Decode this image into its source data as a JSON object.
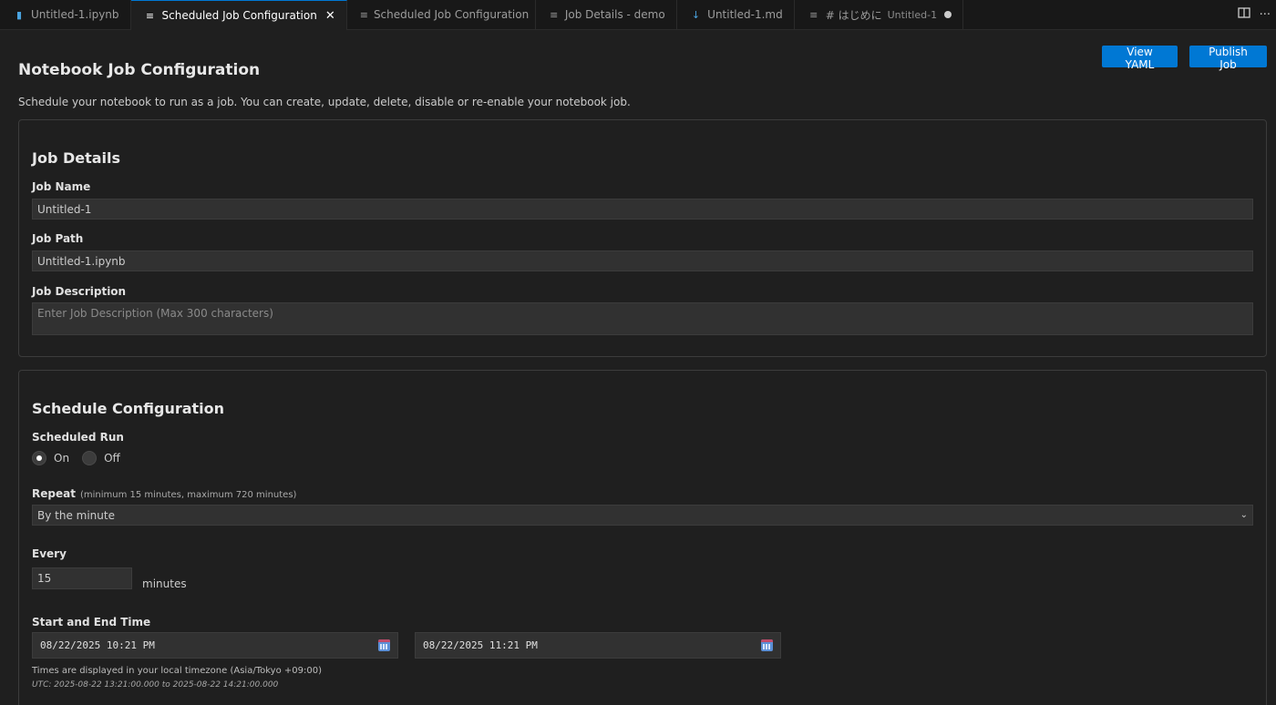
{
  "tabs": [
    {
      "label": "Untitled-1.ipynb",
      "icon": "notebook-icon",
      "active": false
    },
    {
      "label": "Scheduled Job Configuration",
      "icon": "preview-icon",
      "active": true
    },
    {
      "label": "Scheduled Job Configuration",
      "icon": "preview-icon",
      "active": false
    },
    {
      "label": "Job Details - demo",
      "icon": "preview-icon",
      "active": false
    },
    {
      "label": "Untitled-1.md",
      "icon": "markdown-icon",
      "active": false
    },
    {
      "label": "# はじめに",
      "suffix": "Untitled-1",
      "icon": "preview-icon",
      "active": false,
      "dirty": true
    }
  ],
  "tab_actions": {
    "split": "split-editor-icon",
    "more": "···"
  },
  "header": {
    "title": "Notebook Job Configuration",
    "description": "Schedule your notebook to run as a job. You can create, update, delete, disable or re-enable your notebook job.",
    "view_yaml_label": "View YAML",
    "publish_label": "Publish Job"
  },
  "job_details": {
    "title": "Job Details",
    "name_label": "Job Name",
    "name_value": "Untitled-1",
    "path_label": "Job Path",
    "path_value": "Untitled-1.ipynb",
    "description_label": "Job Description",
    "description_placeholder": "Enter Job Description (Max 300 characters)"
  },
  "schedule": {
    "title": "Schedule Configuration",
    "scheduled_run_label": "Scheduled Run",
    "on_label": "On",
    "off_label": "Off",
    "selected": "On",
    "repeat_label": "Repeat",
    "repeat_hint": "(minimum 15 minutes, maximum 720 minutes)",
    "repeat_value": "By the minute",
    "every_label": "Every",
    "every_value": "15",
    "every_unit": "minutes",
    "time_label": "Start and End Time",
    "start_value": "08/22/2025 10:21 PM",
    "end_value": "08/22/2025 11:21 PM",
    "timezone_note": "Times are displayed in your local timezone (Asia/Tokyo +09:00)",
    "utc_note": "UTC: 2025-08-22 13:21:00.000 to 2025-08-22 14:21:00.000"
  },
  "colors": {
    "accent": "#0078d4",
    "background": "#1f1f1f",
    "input": "#313131"
  }
}
